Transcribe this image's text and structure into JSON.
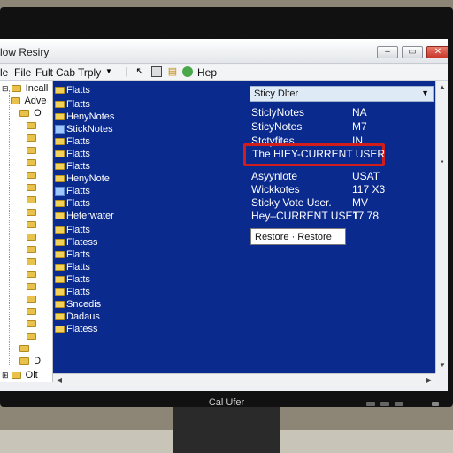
{
  "window": {
    "title": "low Resiry",
    "controls": {
      "minimize": "–",
      "maximize": "▭",
      "close": "✕"
    }
  },
  "menu": {
    "items": [
      "le",
      "File",
      "Fult",
      "Cab",
      "Trply"
    ],
    "help": "Hep"
  },
  "tree": {
    "items": [
      "Incall",
      "Adve",
      "O",
      "D",
      "Oit"
    ]
  },
  "keys": {
    "items": [
      "Flatts",
      "Flatts",
      "HenyNotes",
      "StickNotes",
      "Flatts",
      "Flatts",
      "Flatts",
      "HenyNote",
      "Flatts",
      "Flatts",
      "Heterwater",
      "Flatts",
      "Flatess",
      "Flatts",
      "Flatts",
      "Flatts",
      "Flatts",
      "Sncedis",
      "Dadaus",
      "Flatess"
    ]
  },
  "values": {
    "filter_label": "Sticy Dlter",
    "rows": [
      {
        "name": "SticlyNotes",
        "data": "NA"
      },
      {
        "name": "SticyNotes",
        "data": "M7"
      },
      {
        "name": "Stctyfites",
        "data": "IN"
      }
    ],
    "highlighted": "The HIEY-CURRENT USER",
    "rows2": [
      {
        "name": "Asyynlote",
        "data": "USAT"
      },
      {
        "name": "Wickkotes",
        "data": "117 X3"
      },
      {
        "name": "Sticky Vote User.",
        "data": "MV"
      },
      {
        "name": "Hey–CURRENT USET",
        "data": "17 78"
      }
    ],
    "restore_button": "Restore · Restore"
  },
  "monitor": {
    "label": "Cal Ufer"
  },
  "colors": {
    "pane_bg": "#0b2a8e",
    "highlight_border": "#d21d1d",
    "close_button": "#c8372a"
  }
}
